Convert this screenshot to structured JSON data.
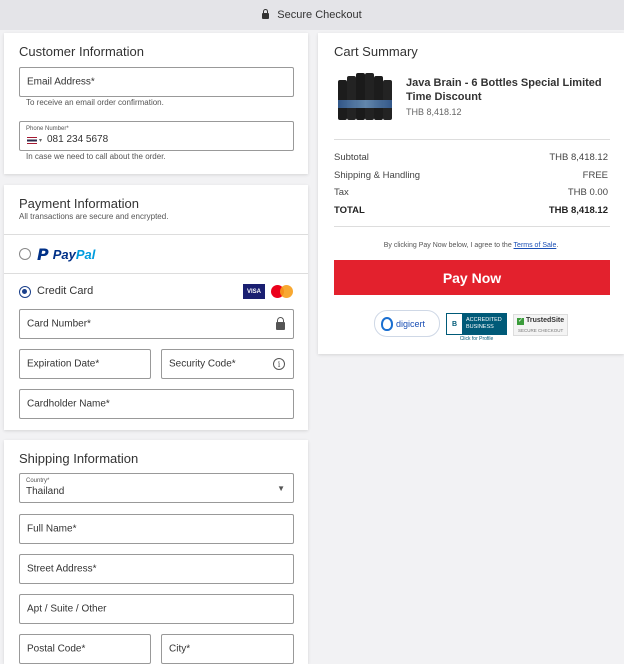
{
  "topbar": {
    "title": "Secure Checkout"
  },
  "customer": {
    "title": "Customer Information",
    "email_label": "Email Address*",
    "email_hint": "To receive an email order confirmation.",
    "phone_label": "Phone Number*",
    "phone_value": "081 234 5678",
    "phone_hint": "In case we need to call about the order."
  },
  "payment": {
    "title": "Payment Information",
    "subtitle": "All transactions are secure and encrypted.",
    "paypal_label": "PayPal",
    "paypal_label_a": "Pay",
    "paypal_label_b": "Pal",
    "credit_label": "Credit Card",
    "visa_label": "VISA",
    "card_number": "Card Number*",
    "expiration": "Expiration Date*",
    "security": "Security Code*",
    "cardholder": "Cardholder Name*"
  },
  "shipping": {
    "title": "Shipping Information",
    "country_label": "Country*",
    "country_value": "Thailand",
    "full_name": "Full Name*",
    "street": "Street Address*",
    "apt": "Apt / Suite / Other",
    "postal": "Postal Code*",
    "city": "City*"
  },
  "summary": {
    "title": "Cart Summary",
    "product_name": "Java Brain - 6 Bottles Special Limited Time Discount",
    "product_price": "THB 8,418.12",
    "rows": [
      {
        "label": "Subtotal",
        "value": "THB 8,418.12"
      },
      {
        "label": "Shipping & Handling",
        "value": "FREE"
      },
      {
        "label": "Tax",
        "value": "THB 0.00"
      },
      {
        "label": "TOTAL",
        "value": "THB 8,418.12"
      }
    ],
    "agree_text": "By clicking Pay Now below, I agree to the",
    "terms_link": "Terms of Sale",
    "agree_end": ".",
    "pay_button": "Pay Now",
    "badges": {
      "digicert": "digicert",
      "bbb_a": "ACCREDITED",
      "bbb_b": "BUSINESS",
      "bbb_click": "Click for Profile",
      "trusted_a": "TrustedSite",
      "trusted_b": "SECURE CHECKOUT"
    }
  },
  "colors": {
    "accent": "#e3212d",
    "brand_blue": "#1a3f8a",
    "paypal_dark": "#003087",
    "paypal_light": "#009cde"
  }
}
